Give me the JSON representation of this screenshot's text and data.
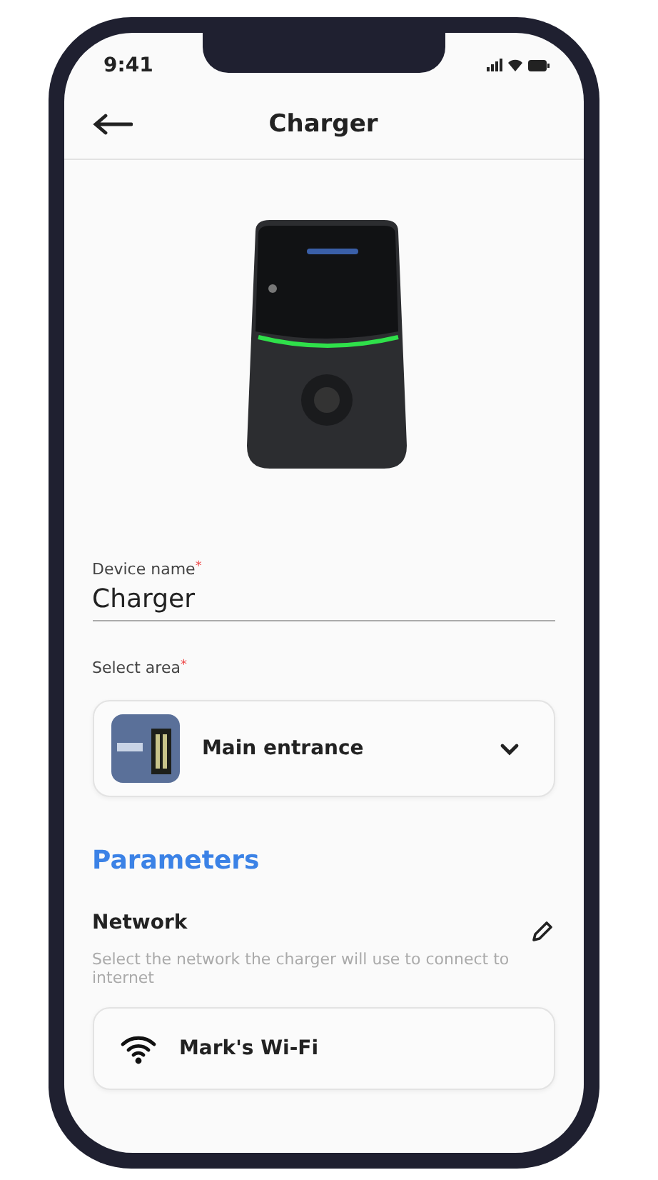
{
  "status_bar": {
    "time": "9:41"
  },
  "header": {
    "title": "Charger"
  },
  "device_name": {
    "label": "Device name",
    "required_mark": "*",
    "value": "Charger"
  },
  "area": {
    "label": "Select area",
    "required_mark": "*",
    "value": "Main entrance"
  },
  "parameters": {
    "title": "Parameters",
    "network": {
      "label": "Network",
      "description": "Select the network the charger will use to connect to internet",
      "value": "Mark's Wi-Fi"
    }
  }
}
